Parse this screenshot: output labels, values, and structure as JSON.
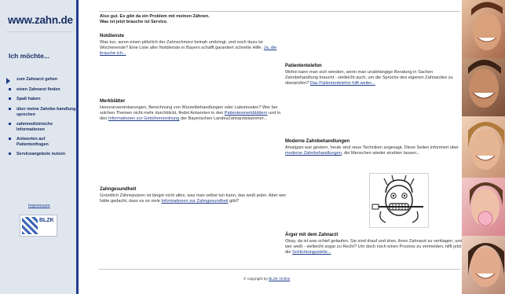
{
  "logo": "www.zahn.de",
  "sidebar": {
    "heading": "Ich möchte...",
    "items": [
      {
        "label": "zum Zahnarzt gehen"
      },
      {
        "label": "einen Zahnarzt finden"
      },
      {
        "label": "Spaß haben"
      },
      {
        "label": "über meine Zahnbe-handlung sprechen"
      },
      {
        "label": "zahnmedizinische Informationen"
      },
      {
        "label": "Antworten auf Patientenfragen"
      },
      {
        "label": "Serviceangebote nutzen"
      }
    ],
    "impressum": "Impressum",
    "blzk_label": "BLZK"
  },
  "intro": {
    "line1": "Also gut. Es gibt da ein Problem mit meinen Zähnen.",
    "line2": "Was ist jetzt brauche ist Service."
  },
  "blocks": {
    "notdienste": {
      "title": "Notdienste",
      "text": "Was tun, wenn einen plötzlich der Zahnschmerz beinah umbringt, und noch dazu ist Wochenende? Eine Liste aller Notdienste in Bayern schafft garantiert schnelle Hilfe.",
      "link": "Ja, die brauche ich..."
    },
    "patiententelefon": {
      "title": "Patiententelefon",
      "text": "Wohin kann man sich wenden, wenn man unabhängige Beratung in Sachen Zahnbehandlung braucht - vielleicht auch, um die Sprüche des eigenen Zahnarztes zu überprüfen?",
      "link": "Das Patiententelefon hilft weiter..."
    },
    "merkblaetter": {
      "title": "Merkblätter",
      "text1": "Honorarvereinbarungen, Berechnung von Wurzelbehandlungen oder Laborkosten? Wer bei solchen Themen nicht mehr durchblickt, findet Antworten in den",
      "link1": "Patientenmerkblättern",
      "text2": "und in den",
      "link2": "Informationen zur Gebührenordnung",
      "text3": "der Bayerischen LandesZahnarztekammer..."
    },
    "moderne": {
      "title": "Moderne Zahnbehandlungen",
      "text1": "Amalgam war gestern, heute sind neue Techniken angesagt. Diese Seiten informiert über",
      "link": "moderne Zahnbehandlungen",
      "text2": ", die Menschen wieder strahlen lassen..."
    },
    "zahngesundheit": {
      "title": "Zahngesundheit",
      "text1": "Gründlich Zähneputzen ist längst nicht alles, was man selbst tun kann, das weiß jeder. Aber wer hätte gedacht, dass es so viele",
      "link": "Informationen zur Zahngesundheit",
      "text2": "gibt?"
    },
    "aerger": {
      "title": "Ärger mit dem Zahnarzt",
      "text": "Okay, da ist was schief gelaufen. Sie sind drauf und dran, ihren Zahnarzt zu verklagen, und wer weiß - vielleicht sogar zu Recht? Um doch noch einen Prozess zu vermeiden, hilft jetzt die",
      "link": "Schlichtungsstelle..."
    }
  },
  "copyright": {
    "text": "© copyright by",
    "link": "BLZK Online"
  },
  "colors": {
    "accent": "#1f3c8c",
    "sidebar_bg": "#dfe6ee",
    "link": "#1f3c8c"
  }
}
